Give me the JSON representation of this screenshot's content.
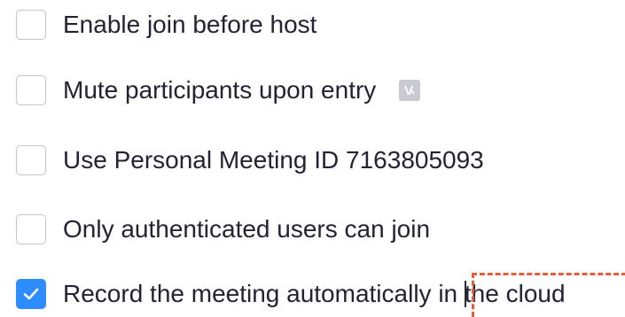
{
  "options": [
    {
      "label": "Enable join before host",
      "checked": false
    },
    {
      "label": "Mute participants upon entry",
      "checked": false,
      "icon": "info-icon"
    },
    {
      "label": "Use Personal Meeting ID 7163805093",
      "checked": false
    },
    {
      "label": "Only authenticated users can join",
      "checked": false
    },
    {
      "label": "Record the meeting automatically in the cloud",
      "checked": true
    }
  ],
  "colors": {
    "accent": "#2d8cff",
    "text": "#232333",
    "checkbox_border": "#c4c4c8",
    "info_icon": "#c9c9d4",
    "highlight": "#e0603a"
  }
}
